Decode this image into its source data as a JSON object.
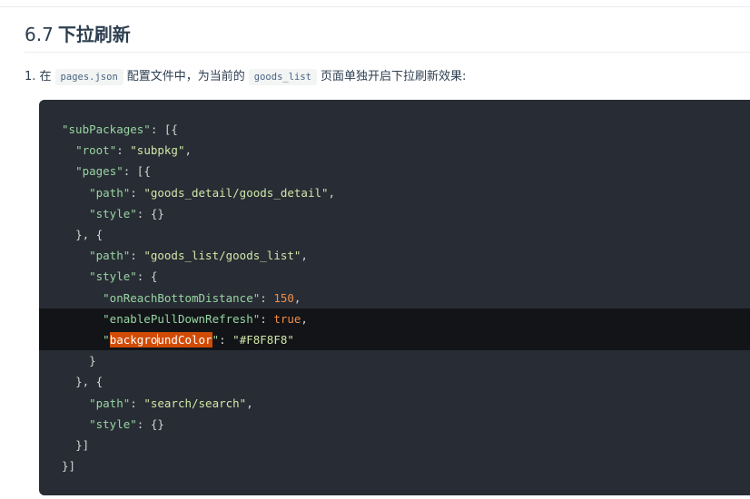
{
  "section": {
    "number": "6.7",
    "title": "下拉刷新"
  },
  "instruction": {
    "prefix": "1. 在",
    "file_code": "pages.json",
    "middle": "配置文件中，为当前的",
    "page_code": "goods_list",
    "suffix": "页面单独开启下拉刷新效果:"
  },
  "code": {
    "l1_key": "\"subPackages\"",
    "l1_rest": ": [{",
    "l2_key": "\"root\"",
    "l2_sep": ": ",
    "l2_val": "\"subpkg\"",
    "l2_end": ",",
    "l3_key": "\"pages\"",
    "l3_rest": ": [{",
    "l4_key": "\"path\"",
    "l4_sep": ": ",
    "l4_val": "\"goods_detail/goods_detail\"",
    "l4_end": ",",
    "l5_key": "\"style\"",
    "l5_rest": ": {}",
    "l6": "}, {",
    "l7_key": "\"path\"",
    "l7_sep": ": ",
    "l7_val": "\"goods_list/goods_list\"",
    "l7_end": ",",
    "l8_key": "\"style\"",
    "l8_rest": ": {",
    "l9_key": "\"onReachBottomDistance\"",
    "l9_sep": ": ",
    "l9_val": "150",
    "l9_end": ",",
    "l10_key": "\"enablePullDownRefresh\"",
    "l10_sep": ": ",
    "l10_val": "true",
    "l10_end": ",",
    "l11_q1": "\"",
    "l11_sel": "backgroundColor",
    "l11_q2": "\"",
    "l11_sep": ": ",
    "l11_val": "\"#F8F8F8\"",
    "l12": "}",
    "l13": "}, {",
    "l14_key": "\"path\"",
    "l14_sep": ": ",
    "l14_val": "\"search/search\"",
    "l14_end": ",",
    "l15_key": "\"style\"",
    "l15_rest": ": {}",
    "l16": "}]",
    "l17": "}]"
  }
}
